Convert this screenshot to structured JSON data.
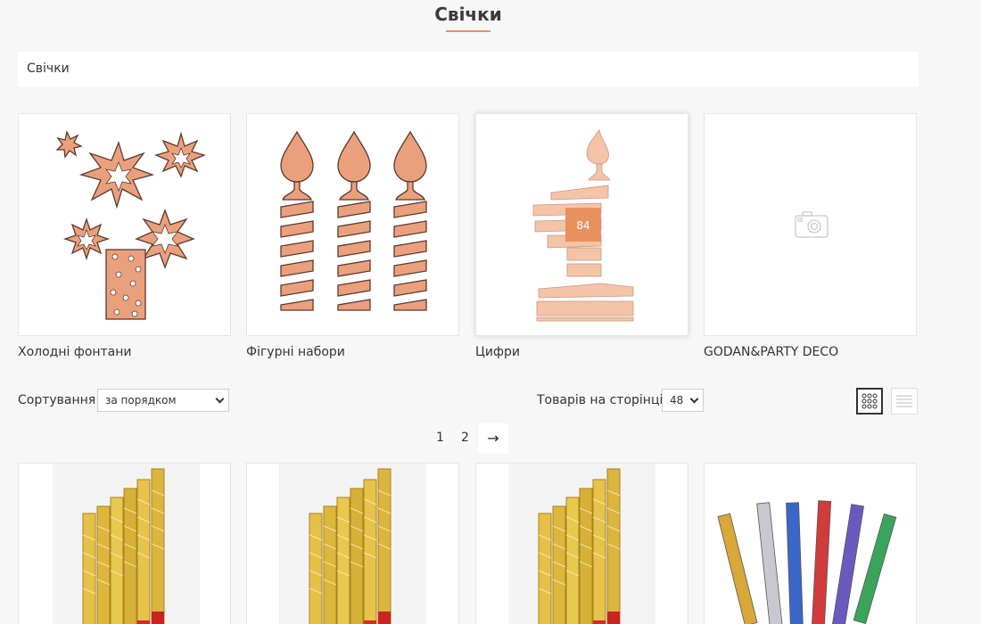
{
  "page": {
    "title": "Свічки"
  },
  "breadcrumb": {
    "current": "Свічки"
  },
  "categories": [
    {
      "label": "Холодні фонтани",
      "icon": "cold-fountain-icon"
    },
    {
      "label": "Фігурні набори",
      "icon": "figured-candles-icon"
    },
    {
      "label": "Цифри",
      "icon": "number-candle-icon",
      "badge": "84"
    },
    {
      "label": "GODAN&PARTY DECO",
      "icon": "camera-placeholder-icon"
    }
  ],
  "toolbar": {
    "sort_label": "Сортування:",
    "sort_value": "за порядком",
    "per_page_label": "Товарів на сторінці:",
    "per_page_value": "48"
  },
  "pagination": {
    "pages": [
      "1",
      "2"
    ],
    "next": "→"
  },
  "colors": {
    "accent": "#e8915f",
    "candle_fill": "#eba07d"
  }
}
